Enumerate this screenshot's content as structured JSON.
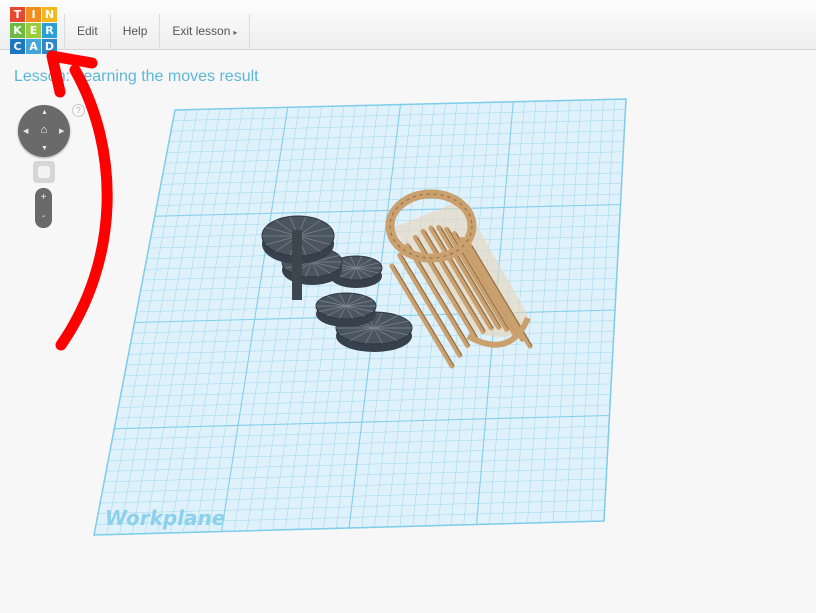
{
  "logo": {
    "letters": [
      "T",
      "I",
      "N",
      "K",
      "E",
      "R",
      "C",
      "A",
      "D"
    ],
    "colors": [
      "#e8472f",
      "#f28c1d",
      "#f5b81c",
      "#6cb944",
      "#9bcc3d",
      "#2aa0d6",
      "#1d77c0",
      "#47a6d8",
      "#2f86c8"
    ]
  },
  "menu": {
    "edit": "Edit",
    "help": "Help",
    "exit_lesson": "Exit lesson"
  },
  "lesson_title": "Lesson: Learning the moves result",
  "controls": {
    "help_mark": "?",
    "zoom_in": "+",
    "zoom_out": "-"
  },
  "workplane": {
    "label": "Workplane",
    "grid_color": "#7fcdea",
    "fill_color": "#dff1fa"
  },
  "colors": {
    "accent_title": "#5bb7d9",
    "annotation_arrow": "#ff0000",
    "staircase": "#4b5560",
    "cylinder": "#c9a06e"
  },
  "icons": [
    "home-icon",
    "arrow-up-icon",
    "arrow-down-icon",
    "arrow-left-icon",
    "arrow-right-icon",
    "view-cube-icon",
    "caret-right-icon"
  ]
}
